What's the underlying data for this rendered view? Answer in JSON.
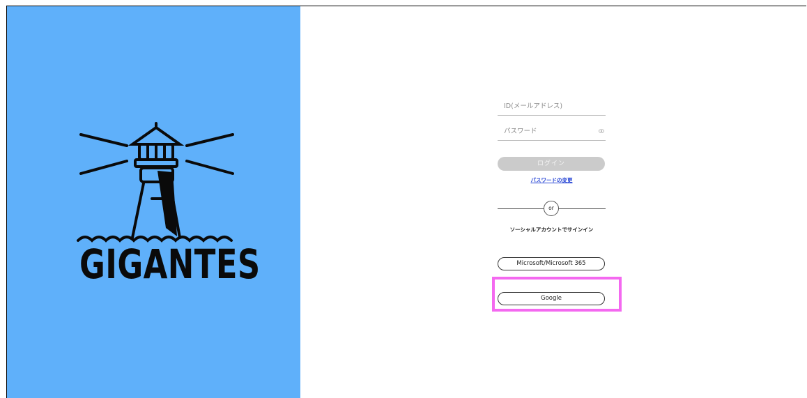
{
  "brand": {
    "name": "GIGANTES"
  },
  "login_form": {
    "id_placeholder": "ID(メールアドレス)",
    "password_placeholder": "パスワード",
    "password_icon": "eye-icon",
    "login_label": "ログイン",
    "change_password_link": "パスワードの変更",
    "divider_text": "or",
    "social_caption": "ソーシャルアカウントでサインイン",
    "social_buttons": [
      {
        "label": "Microsoft/Microsoft 365"
      },
      {
        "label": "Google"
      }
    ]
  },
  "colors": {
    "left_panel_bg": "#5fb0fa",
    "login_button_bg": "#cbcbcb",
    "link": "#2b49d6",
    "highlight": "#f469f0"
  }
}
